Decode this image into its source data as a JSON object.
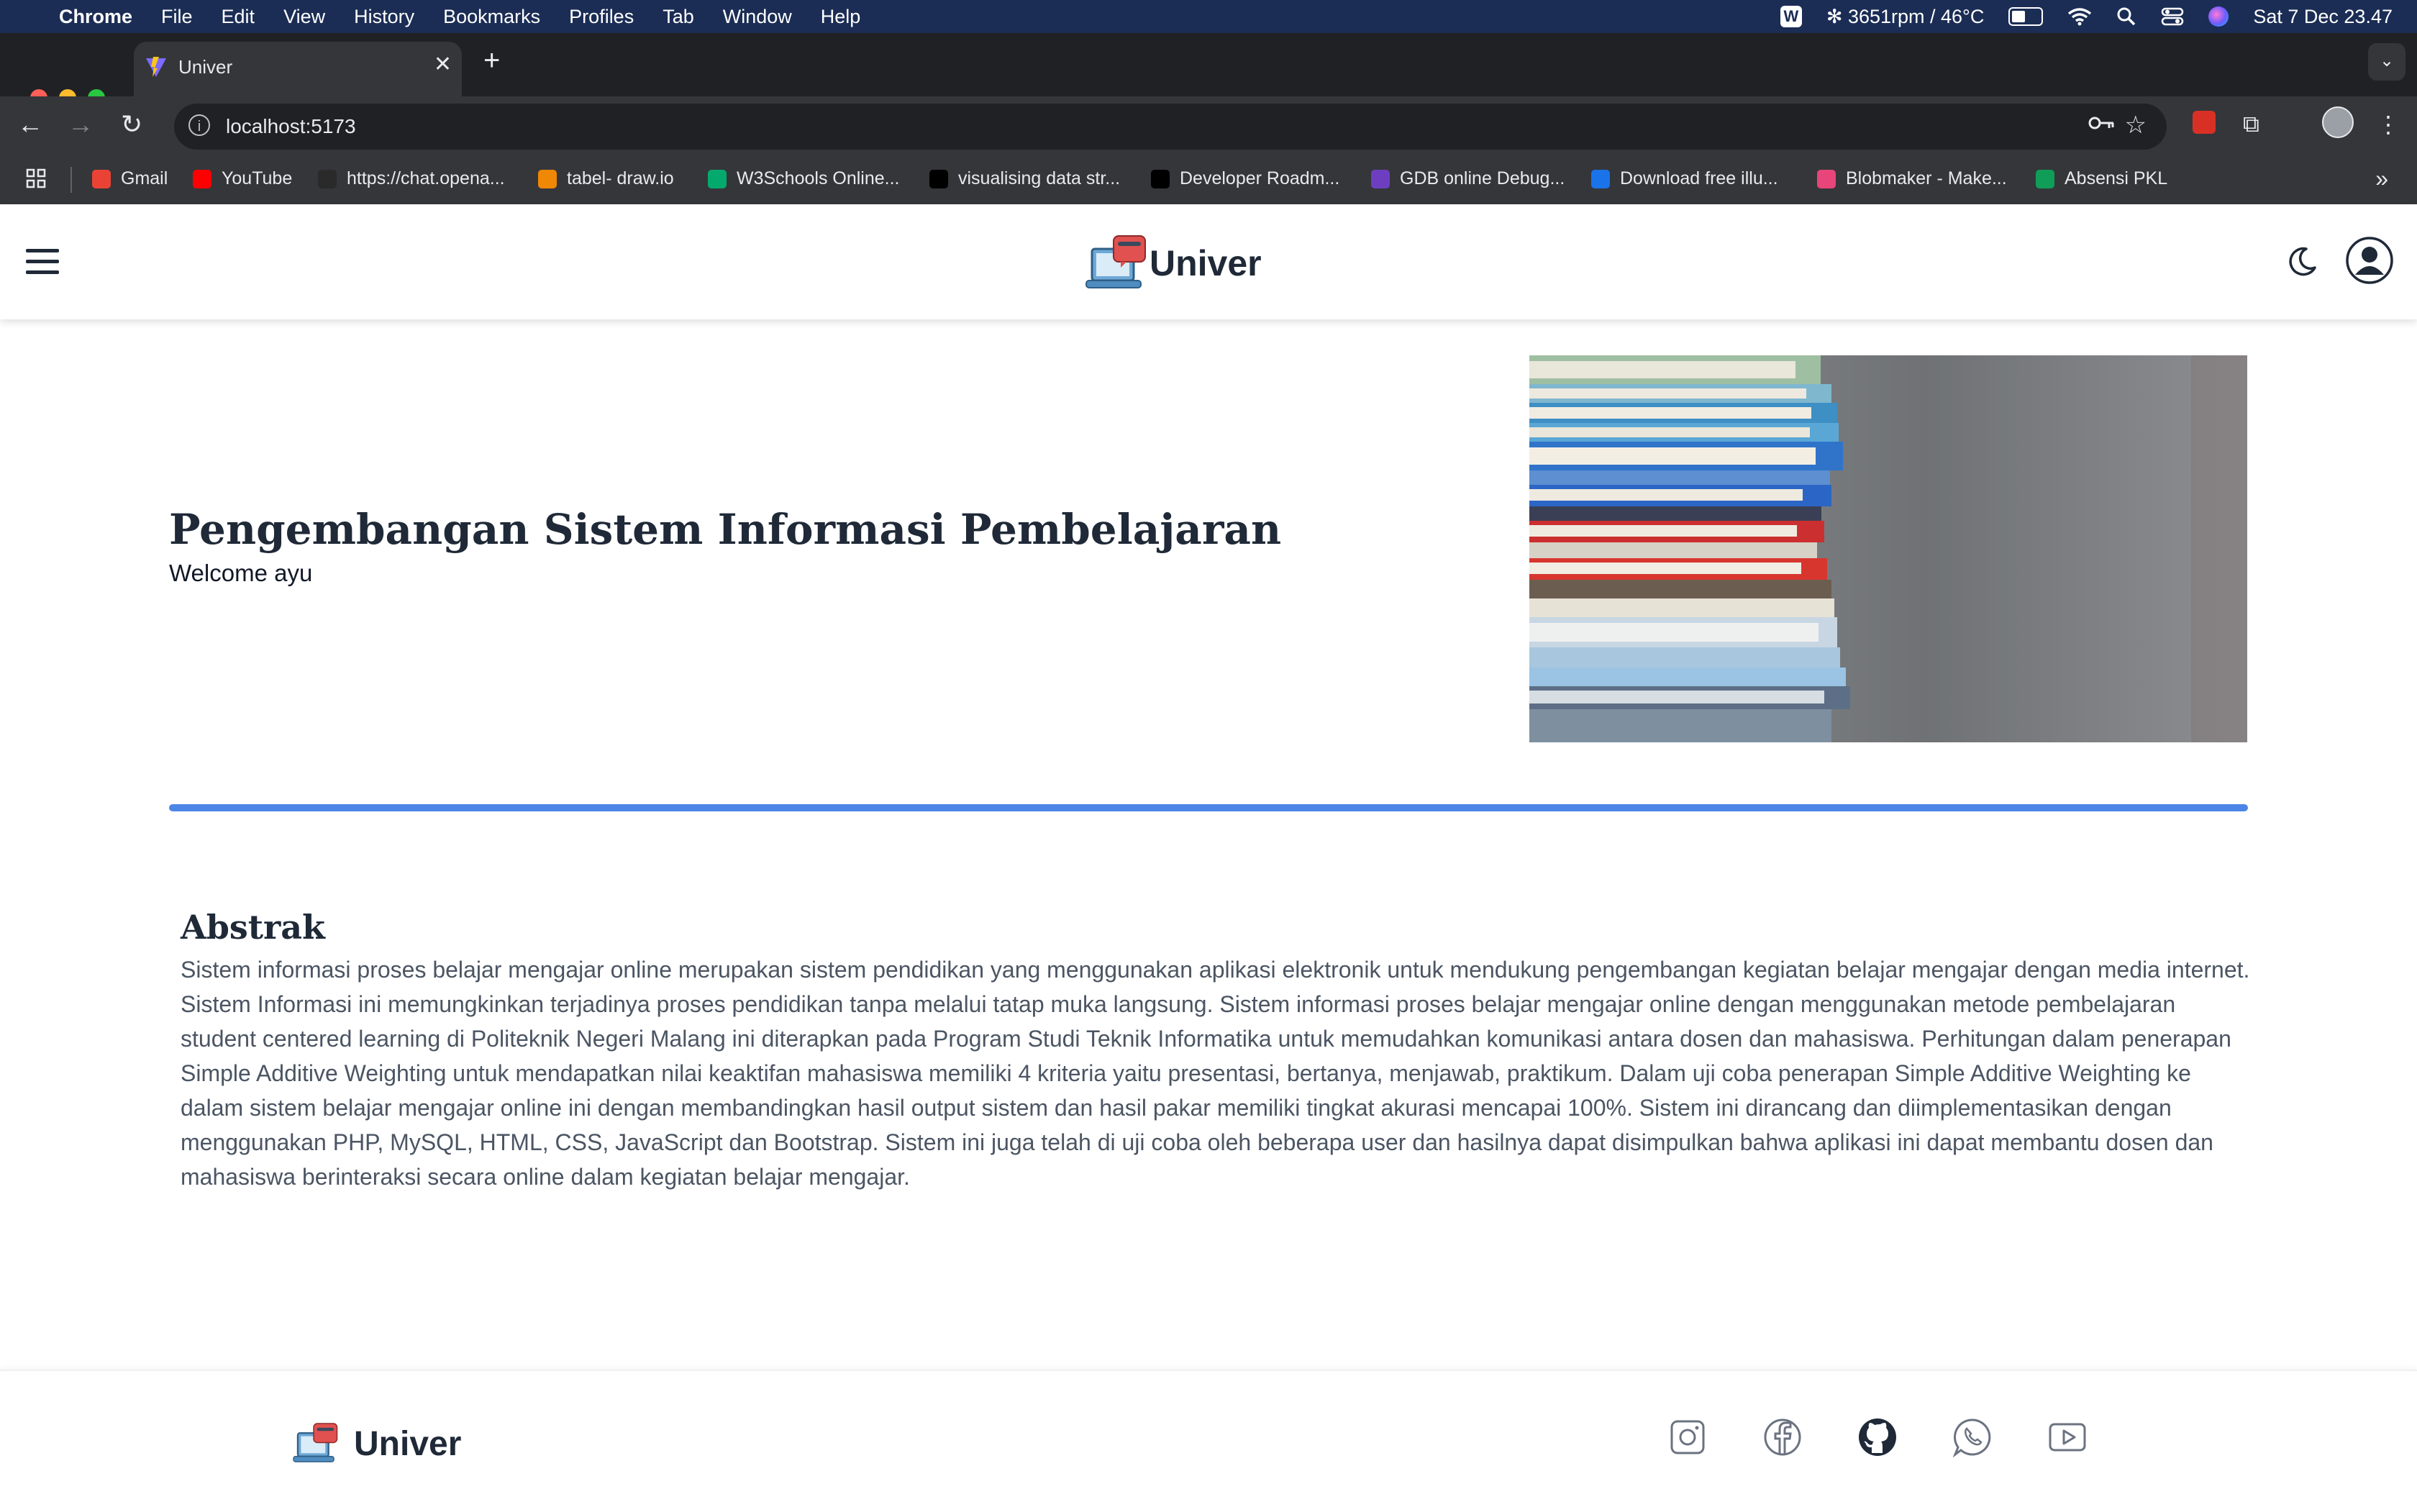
{
  "menubar": {
    "app": "Chrome",
    "items": [
      "File",
      "Edit",
      "View",
      "History",
      "Bookmarks",
      "Profiles",
      "Tab",
      "Window",
      "Help"
    ],
    "status_fan": "3651rpm / 46°C",
    "datetime": "Sat 7 Dec  23.47"
  },
  "browser": {
    "tab_title": "Univer",
    "url": "localhost:5173",
    "bookmarks": [
      {
        "label": "Gmail",
        "icon": "gmail-icon",
        "color": "#ea4335"
      },
      {
        "label": "YouTube",
        "icon": "youtube-icon",
        "color": "#ff0000"
      },
      {
        "label": "https://chat.opena...",
        "icon": "openai-icon",
        "color": "#2a2a2a"
      },
      {
        "label": "tabel- draw.io",
        "icon": "drawio-icon",
        "color": "#f08705"
      },
      {
        "label": "W3Schools Online...",
        "icon": "w3schools-icon",
        "color": "#04aa6d"
      },
      {
        "label": "visualising data str...",
        "icon": "visualgo-icon",
        "color": "#000000"
      },
      {
        "label": "Developer Roadm...",
        "icon": "roadmap-icon",
        "color": "#000000"
      },
      {
        "label": "GDB online Debug...",
        "icon": "gdb-icon",
        "color": "#6d3fc0"
      },
      {
        "label": "Download free illu...",
        "icon": "illustration-icon",
        "color": "#1a73e8"
      },
      {
        "label": "Blobmaker - Make...",
        "icon": "blobmaker-icon",
        "color": "#e8457a"
      },
      {
        "label": "Absensi PKL",
        "icon": "sheets-icon",
        "color": "#0f9d58"
      }
    ]
  },
  "header": {
    "brand": "Univer"
  },
  "hero": {
    "title": "Pengembangan Sistem Informasi Pembelajaran",
    "welcome": "Welcome ayu"
  },
  "abstract": {
    "title": "Abstrak",
    "text": "Sistem informasi proses belajar mengajar online merupakan sistem pendidikan yang menggunakan aplikasi elektronik untuk mendukung pengembangan kegiatan belajar mengajar dengan media internet. Sistem Informasi ini memungkinkan terjadinya proses pendidikan tanpa melalui tatap muka langsung. Sistem informasi proses belajar mengajar online dengan menggunakan metode pembelajaran student centered learning di Politeknik Negeri Malang ini diterapkan pada Program Studi Teknik Informatika untuk memudahkan komunikasi antara dosen dan mahasiswa. Perhitungan dalam penerapan Simple Additive Weighting untuk mendapatkan nilai keaktifan mahasiswa memiliki 4 kriteria yaitu presentasi, bertanya, menjawab, praktikum. Dalam uji coba penerapan Simple Additive Weighting ke dalam sistem belajar mengajar online ini dengan membandingkan hasil output sistem dan hasil pakar memiliki tingkat akurasi mencapai 100%. Sistem ini dirancang dan diimplementasikan dengan menggunakan PHP, MySQL, HTML, CSS, JavaScript dan Bootstrap. Sistem ini juga telah di uji coba oleh beberapa user dan hasilnya dapat disimpulkan bahwa aplikasi ini dapat membantu dosen dan mahasiswa berinteraksi secara online dalam kegiatan belajar mengajar."
  },
  "footer": {
    "brand": "Univer",
    "social": [
      "instagram-icon",
      "facebook-icon",
      "github-icon",
      "whatsapp-icon",
      "youtube-icon"
    ]
  },
  "colors": {
    "accent_divider": "#4b86e6",
    "heading": "#1f2937",
    "body_text": "#4b5563"
  }
}
